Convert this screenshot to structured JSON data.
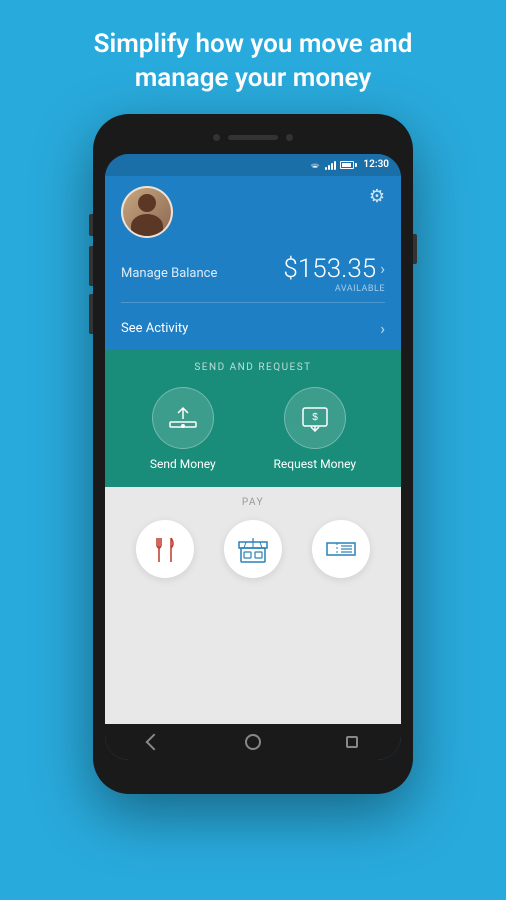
{
  "header": {
    "line1": "Simplify how you move and",
    "line2": "manage your money"
  },
  "status_bar": {
    "time": "12:30"
  },
  "balance_section": {
    "manage_label": "Manage Balance",
    "amount": "$153.35",
    "available": "AVAILABLE"
  },
  "activity": {
    "label": "See Activity"
  },
  "send_request": {
    "section_title": "SEND AND REQUEST",
    "send_label": "Send Money",
    "request_label": "Request Money"
  },
  "pay": {
    "section_title": "PAY",
    "items": [
      "restaurant",
      "store",
      "ticket"
    ]
  },
  "nav": {
    "back": "back",
    "home": "home",
    "recent": "recent"
  }
}
